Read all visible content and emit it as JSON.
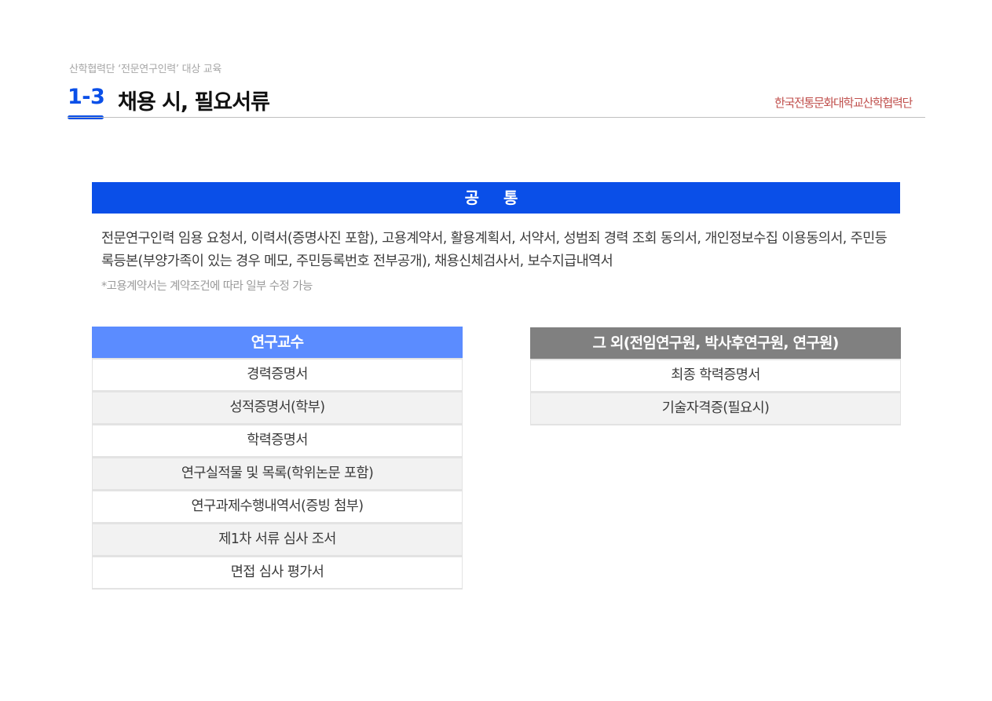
{
  "header": {
    "subtitle": "산학협력단 ‘전문연구인력’ 대상 교육",
    "section_number": "1-3",
    "title": "채용 시, 필요서류",
    "logo_text": "한국전통문화대학교산학협력단"
  },
  "common": {
    "heading": "공 통",
    "documents": "전문연구인력 임용 요청서, 이력서(증명사진 포함), 고용계약서, 활용계획서, 서약서, 성범죄 경력 조회 동의서, 개인정보수집 이용동의서, 주민등록등본(부양가족이 있는 경우 메모, 주민등록번호 전부공개), 채용신체검사서, 보수지급내역서",
    "note": "*고용계약서는 계약조건에 따라 일부 수정 가능"
  },
  "professor_table": {
    "heading": "연구교수",
    "rows": [
      "경력증명서",
      "성적증명서(학부)",
      "학력증명서",
      "연구실적물 및 목록(학위논문 포함)",
      "연구과제수행내역서(증빙 첨부)",
      "제1차 서류 심사 조서",
      "면접 심사 평가서"
    ]
  },
  "other_table": {
    "heading": "그 외(전임연구원, 박사후연구원, 연구원)",
    "rows": [
      "최종 학력증명서",
      "기술자격증(필요시)"
    ]
  },
  "colors": {
    "primary_blue": "#0a4fe8",
    "light_blue": "#5b8cff",
    "gray_header": "#808080",
    "logo_red": "#c0504d"
  }
}
